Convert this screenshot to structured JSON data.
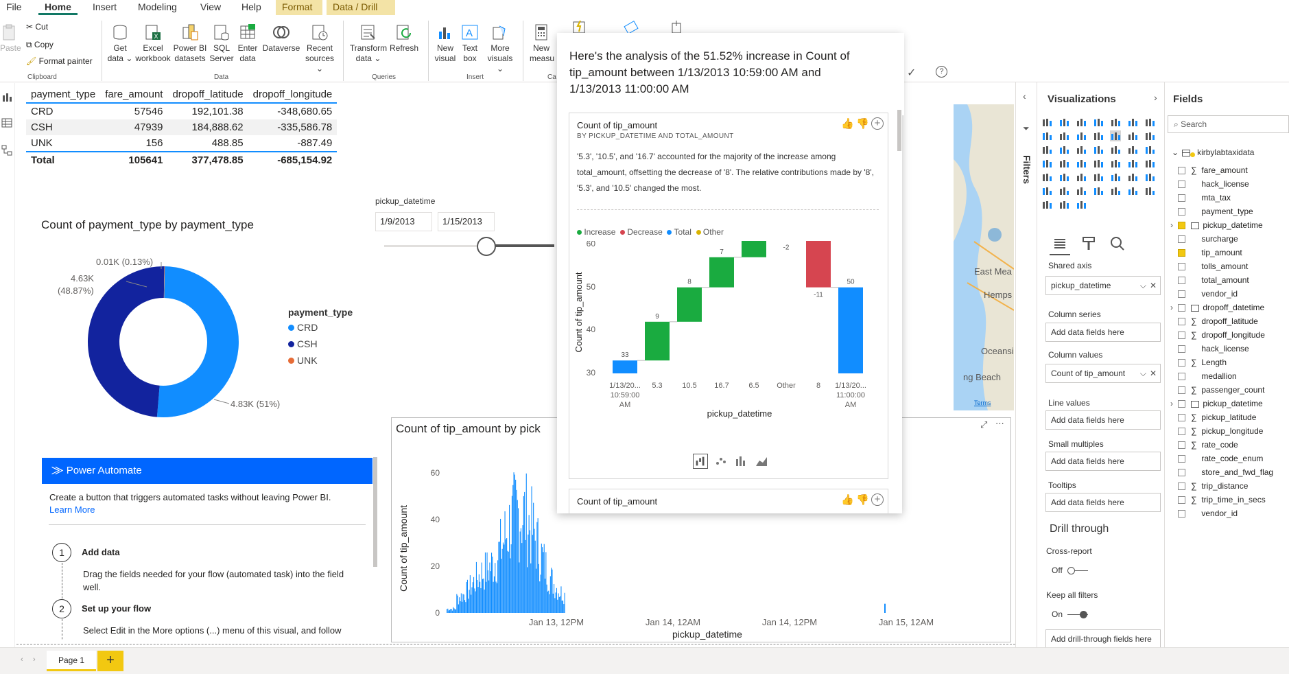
{
  "ribbon": {
    "tabs": [
      "File",
      "Home",
      "Insert",
      "Modeling",
      "View",
      "Help",
      "Format",
      "Data / Drill"
    ],
    "clipboard": {
      "paste": "Paste",
      "cut": "Cut",
      "copy": "Copy",
      "format_painter": "Format painter",
      "group": "Clipboard"
    },
    "data_buttons": [
      {
        "line1": "Get",
        "line2": "data ⌄"
      },
      {
        "line1": "Excel",
        "line2": "workbook"
      },
      {
        "line1": "Power BI",
        "line2": "datasets"
      },
      {
        "line1": "SQL",
        "line2": "Server"
      },
      {
        "line1": "Enter",
        "line2": "data"
      },
      {
        "line1": "Dataverse",
        "line2": ""
      },
      {
        "line1": "Recent",
        "line2": "sources ⌄"
      }
    ],
    "data_group": "Data",
    "queries_buttons": [
      {
        "line1": "Transform",
        "line2": "data ⌄"
      },
      {
        "line1": "Refresh",
        "line2": ""
      }
    ],
    "queries_group": "Queries",
    "insert_buttons": [
      {
        "line1": "New",
        "line2": "visual"
      },
      {
        "line1": "Text",
        "line2": "box"
      },
      {
        "line1": "More",
        "line2": "visuals ⌄"
      }
    ],
    "insert_group": "Insert",
    "calc_buttons": [
      {
        "line1": "New",
        "line2": "measu"
      }
    ],
    "calc_group": "Ca"
  },
  "table": {
    "headers": [
      "payment_type",
      "fare_amount",
      "dropoff_latitude",
      "dropoff_longitude"
    ],
    "rows": [
      [
        "CRD",
        "57546",
        "192,101.38",
        "-348,680.65"
      ],
      [
        "CSH",
        "47939",
        "184,888.62",
        "-335,586.78"
      ],
      [
        "UNK",
        "156",
        "488.85",
        "-887.49"
      ]
    ],
    "total": [
      "Total",
      "105641",
      "377,478.85",
      "-685,154.92"
    ]
  },
  "donut": {
    "title": "Count of payment_type by payment_type",
    "legend_title": "payment_type",
    "labels": {
      "unk": "0.01K (0.13%)",
      "csh_1": "4.63K",
      "csh_2": "(48.87%)",
      "crd": "4.83K (51%)"
    },
    "chart_data": {
      "type": "pie",
      "categories": [
        "CRD",
        "CSH",
        "UNK"
      ],
      "values": [
        4830,
        4630,
        10
      ],
      "percent": [
        51,
        48.87,
        0.13
      ]
    },
    "colors": {
      "CRD": "#118dff",
      "CSH": "#12239e",
      "UNK": "#e66c37"
    }
  },
  "slicer": {
    "title": "pickup_datetime",
    "start": "1/9/2013",
    "end": "1/15/2013"
  },
  "power_automate": {
    "header": "Power Automate",
    "intro": "Create a button that triggers automated tasks without leaving Power BI.",
    "learn_more": "Learn More",
    "steps": [
      {
        "num": "1",
        "title": "Add data",
        "text": "Drag the fields needed for your flow (automated task) into the field well."
      },
      {
        "num": "2",
        "title": "Set up your flow",
        "text": "Select Edit in the More options (...) menu of this visual, and follow"
      }
    ]
  },
  "column_chart": {
    "title": "Count of tip_amount by pick",
    "ylabel": "Count of tip_amount",
    "xlabel": "pickup_datetime",
    "yticks": [
      "0",
      "20",
      "40",
      "60"
    ],
    "xticks": [
      "Jan 13, 12PM",
      "Jan 14, 12AM",
      "Jan 14, 12PM",
      "Jan 15, 12AM"
    ],
    "color": "#118dff",
    "chart_data": {
      "type": "bar",
      "ylim": [
        0,
        70
      ],
      "note_range": "Jan 13 to Jan 15",
      "peak": 67
    }
  },
  "analysis": {
    "headline": "Here's the analysis of the 51.52% increase in Count of tip_amount between 1/13/2013 10:59:00 AM and 1/13/2013 11:00:00 AM",
    "card1": {
      "title": "Count of tip_amount",
      "subtitle": "BY PICKUP_DATETIME AND TOTAL_AMOUNT",
      "body": "'5.3', '10.5', and '16.7' accounted for the majority of the increase among total_amount, offsetting the decrease of '8'. The relative contributions made by '8', '5.3', and '10.5' changed the most.",
      "legend": [
        "Increase",
        "Decrease",
        "Total",
        "Other"
      ],
      "ylabel": "Count of tip_amount",
      "xlabel": "pickup_datetime",
      "yticks": [
        "30",
        "40",
        "50",
        "60"
      ]
    },
    "card2": {
      "title": "Count of tip_amount"
    },
    "colors": {
      "Increase": "#1aab40",
      "Decrease": "#d64550",
      "Total": "#118dff",
      "Other": "#d9b300"
    }
  },
  "waterfall": {
    "chart_data": {
      "type": "bar",
      "subtype": "waterfall",
      "categories": [
        "1/13/20... 10:59:00 AM",
        "5.3",
        "10.5",
        "16.7",
        "6.5",
        "Other",
        "8",
        "1/13/20... 11:00:00 AM"
      ],
      "values": [
        33,
        9,
        8,
        7,
        6,
        -2,
        -11,
        50
      ],
      "kinds": [
        "Total",
        "Increase",
        "Increase",
        "Increase",
        "Increase",
        "Other",
        "Decrease",
        "Total"
      ],
      "labels": [
        "33",
        "9",
        "8",
        "7",
        "6",
        "-2",
        "-11",
        "50"
      ],
      "ylim": [
        30,
        63
      ]
    }
  },
  "filters": {
    "label": "Filters"
  },
  "visualizations": {
    "title": "Visualizations",
    "shared_axis": "Shared axis",
    "shared_axis_value": "pickup_datetime",
    "column_series": "Column series",
    "column_values": "Column values",
    "column_values_value": "Count of tip_amount",
    "line_values": "Line values",
    "small_multiples": "Small multiples",
    "tooltips": "Tooltips",
    "placeholder": "Add data fields here",
    "drill_through": "Drill through",
    "cross_report": "Cross-report",
    "off": "Off",
    "keep_filters": "Keep all filters",
    "on": "On",
    "add_drill": "Add drill-through fields here"
  },
  "fields": {
    "title": "Fields",
    "search_placeholder": "Search",
    "table": "kirbylabtaxidata",
    "items": [
      {
        "name": "fare_amount",
        "sigma": true,
        "checked": false
      },
      {
        "name": "hack_license",
        "sigma": false,
        "checked": false
      },
      {
        "name": "mta_tax",
        "sigma": false,
        "checked": false
      },
      {
        "name": "payment_type",
        "sigma": false,
        "checked": false
      },
      {
        "name": "pickup_datetime",
        "sigma": false,
        "checked": true,
        "date": true
      },
      {
        "name": "surcharge",
        "sigma": false,
        "checked": false
      },
      {
        "name": "tip_amount",
        "sigma": false,
        "checked": true
      },
      {
        "name": "tolls_amount",
        "sigma": false,
        "checked": false
      },
      {
        "name": "total_amount",
        "sigma": false,
        "checked": false
      },
      {
        "name": "vendor_id",
        "sigma": false,
        "checked": false
      },
      {
        "name": "dropoff_datetime",
        "sigma": false,
        "checked": false,
        "date": true
      },
      {
        "name": "dropoff_latitude",
        "sigma": true,
        "checked": false
      },
      {
        "name": "dropoff_longitude",
        "sigma": true,
        "checked": false
      },
      {
        "name": "hack_license",
        "sigma": false,
        "checked": false
      },
      {
        "name": "Length",
        "sigma": true,
        "checked": false
      },
      {
        "name": "medallion",
        "sigma": false,
        "checked": false
      },
      {
        "name": "passenger_count",
        "sigma": true,
        "checked": false
      },
      {
        "name": "pickup_datetime",
        "sigma": false,
        "checked": false,
        "date": true
      },
      {
        "name": "pickup_latitude",
        "sigma": true,
        "checked": false
      },
      {
        "name": "pickup_longitude",
        "sigma": true,
        "checked": false
      },
      {
        "name": "rate_code",
        "sigma": true,
        "checked": false
      },
      {
        "name": "rate_code_enum",
        "sigma": false,
        "checked": false
      },
      {
        "name": "store_and_fwd_flag",
        "sigma": false,
        "checked": false
      },
      {
        "name": "trip_distance",
        "sigma": true,
        "checked": false
      },
      {
        "name": "trip_time_in_secs",
        "sigma": true,
        "checked": false
      },
      {
        "name": "vendor_id",
        "sigma": false,
        "checked": false
      }
    ]
  },
  "map": {
    "labels": [
      "East Mea",
      "Hemps",
      "Oceansi",
      "ng Beach"
    ],
    "terms": "Terms"
  },
  "pages": {
    "page1": "Page 1",
    "add": "+"
  }
}
